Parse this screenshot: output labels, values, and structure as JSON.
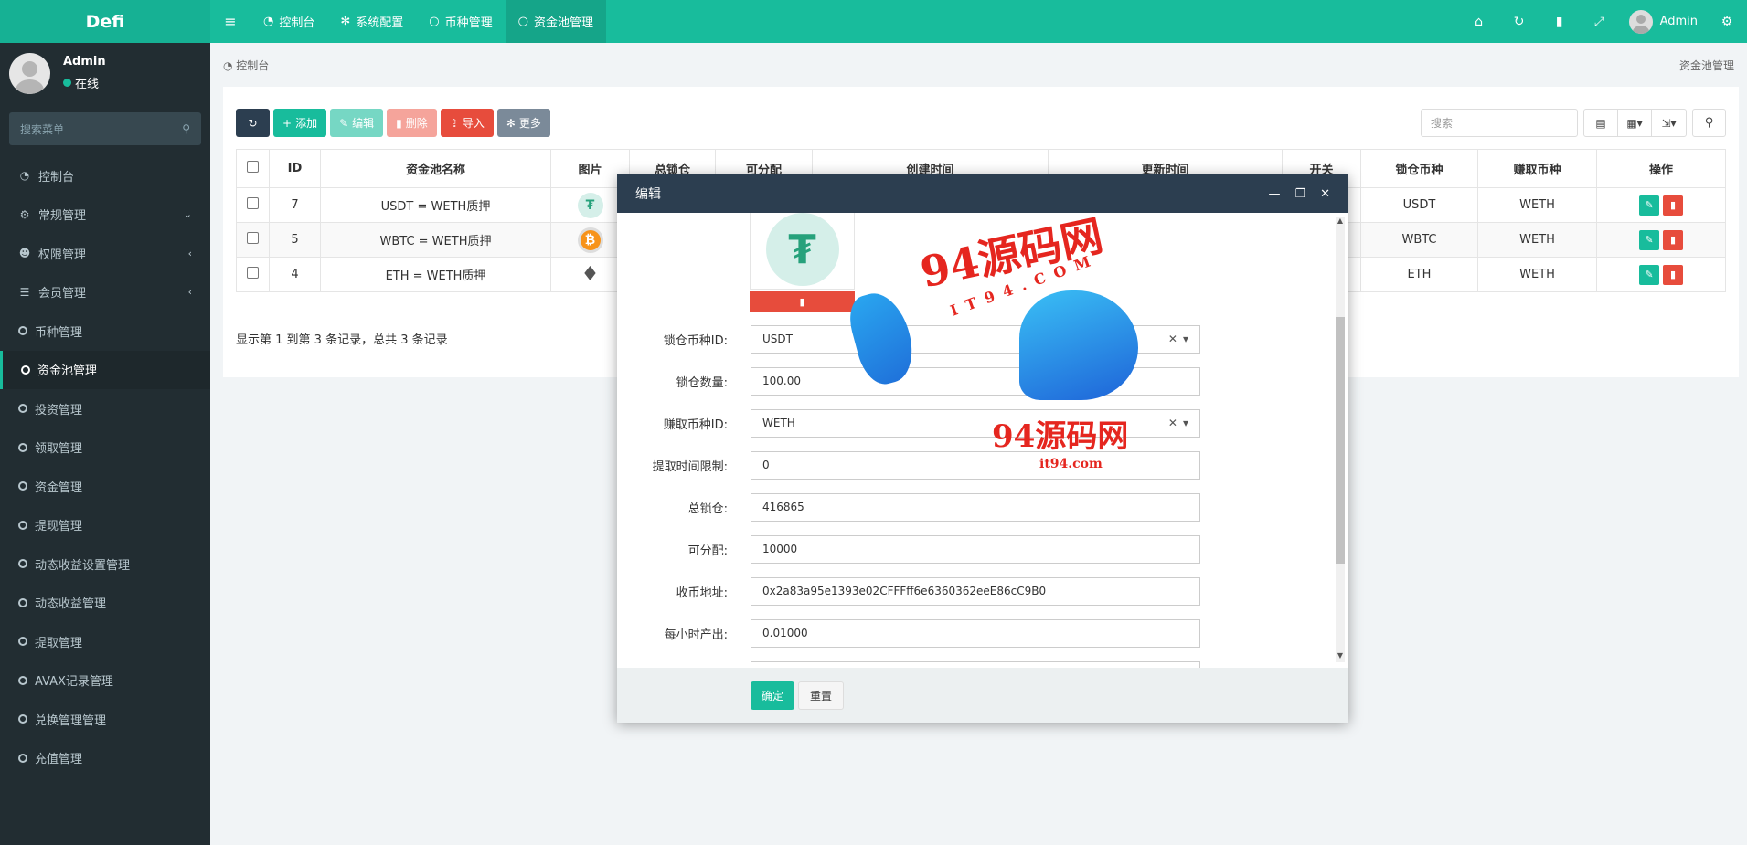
{
  "app": {
    "logo": "Defi"
  },
  "topnav": [
    {
      "label": "控制台",
      "icon": "dashboard-icon",
      "active": false
    },
    {
      "label": "系统配置",
      "icon": "gear-icon",
      "active": false
    },
    {
      "label": "币种管理",
      "icon": "circle-icon",
      "active": false
    },
    {
      "label": "资金池管理",
      "icon": "circle-icon",
      "active": true
    }
  ],
  "topright": {
    "user": "Admin"
  },
  "sidebar": {
    "user_name": "Admin",
    "user_status": "在线",
    "search_placeholder": "搜索菜单",
    "items": [
      {
        "label": "控制台",
        "icon": "dashboard-icon"
      },
      {
        "label": "常规管理",
        "icon": "cogs-icon",
        "caret": "down"
      },
      {
        "label": "权限管理",
        "icon": "group-icon",
        "caret": "left"
      },
      {
        "label": "会员管理",
        "icon": "list-icon",
        "caret": "left"
      },
      {
        "label": "币种管理",
        "icon": "circle-icon"
      },
      {
        "label": "资金池管理",
        "icon": "circle-icon",
        "active": true
      },
      {
        "label": "投资管理",
        "icon": "circle-icon"
      },
      {
        "label": "领取管理",
        "icon": "circle-icon"
      },
      {
        "label": "资金管理",
        "icon": "circle-icon"
      },
      {
        "label": "提现管理",
        "icon": "circle-icon"
      },
      {
        "label": "动态收益设置管理",
        "icon": "circle-icon"
      },
      {
        "label": "动态收益管理",
        "icon": "circle-icon"
      },
      {
        "label": "提取管理",
        "icon": "circle-icon"
      },
      {
        "label": "AVAX记录管理",
        "icon": "circle-icon"
      },
      {
        "label": "兑换管理管理",
        "icon": "circle-icon"
      },
      {
        "label": "充值管理",
        "icon": "circle-icon"
      }
    ]
  },
  "breadcrumb": {
    "left": "控制台",
    "right": "资金池管理"
  },
  "toolbar": {
    "add": "添加",
    "edit": "编辑",
    "delete": "删除",
    "import": "导入",
    "more": "更多",
    "search_placeholder": "搜索"
  },
  "table": {
    "headers": [
      "ID",
      "资金池名称",
      "图片",
      "总锁仓",
      "可分配",
      "创建时间",
      "更新时间",
      "开关",
      "锁仓币种",
      "赚取币种",
      "操作"
    ],
    "rows": [
      {
        "id": "7",
        "name": "USDT = WETH质押",
        "coin": "usdt",
        "lock_coin": "USDT",
        "earn_coin": "WETH"
      },
      {
        "id": "5",
        "name": "WBTC = WETH质押",
        "coin": "btc",
        "lock_coin": "WBTC",
        "earn_coin": "WETH"
      },
      {
        "id": "4",
        "name": "ETH = WETH质押",
        "coin": "eth",
        "lock_coin": "ETH",
        "earn_coin": "WETH"
      }
    ],
    "page_info": "显示第 1 到第 3 条记录，总共 3 条记录"
  },
  "modal": {
    "title": "编辑",
    "fields": [
      {
        "label": "锁仓币种ID:",
        "value": "USDT",
        "type": "select"
      },
      {
        "label": "锁仓数量:",
        "value": "100.00"
      },
      {
        "label": "赚取币种ID:",
        "value": "WETH",
        "type": "select"
      },
      {
        "label": "提取时间限制:",
        "value": "0"
      },
      {
        "label": "总锁仓:",
        "value": "416865"
      },
      {
        "label": "可分配:",
        "value": "10000"
      },
      {
        "label": "收币地址:",
        "value": "0x2a83a95e1393e02CFFFff6e6360362eeE86cC9B0"
      },
      {
        "label": "每小时产出:",
        "value": "0.01000"
      }
    ],
    "ok": "确定",
    "reset": "重置"
  },
  "watermark": {
    "line1": "94源码网",
    "line2": "IT94.COM",
    "line3": "94源码网",
    "line4": "it94.com"
  },
  "colors": {
    "primary": "#18bc9c",
    "sidebar": "#222d32",
    "danger": "#e74c3c",
    "header_dark": "#2c3e50"
  }
}
